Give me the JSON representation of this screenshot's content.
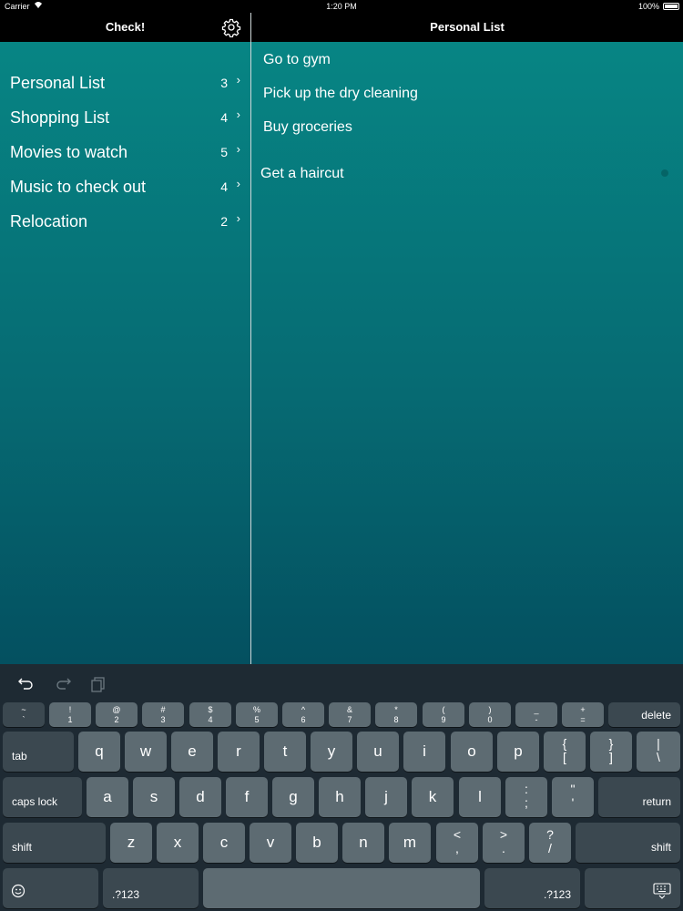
{
  "status": {
    "carrier": "Carrier",
    "time": "1:20 PM",
    "battery": "100%"
  },
  "master": {
    "title": "Check!",
    "lists": [
      {
        "name": "Personal List",
        "count": "3"
      },
      {
        "name": "Shopping List",
        "count": "4"
      },
      {
        "name": "Movies to watch",
        "count": "5"
      },
      {
        "name": "Music to check out",
        "count": "4"
      },
      {
        "name": "Relocation",
        "count": "2"
      }
    ]
  },
  "detail": {
    "title": "Personal List",
    "items": [
      "Go to gym",
      "Pick up the dry cleaning",
      "Buy groceries",
      "Get a haircut"
    ]
  },
  "keyboard": {
    "num_row": [
      [
        "~",
        "`"
      ],
      [
        "!",
        "1"
      ],
      [
        "@",
        "2"
      ],
      [
        "#",
        "3"
      ],
      [
        "$",
        "4"
      ],
      [
        "%",
        "5"
      ],
      [
        "^",
        "6"
      ],
      [
        "&",
        "7"
      ],
      [
        "*",
        "8"
      ],
      [
        "(",
        "9"
      ],
      [
        ")",
        "0"
      ],
      [
        "_",
        "-"
      ],
      [
        "+",
        "="
      ]
    ],
    "delete": "delete",
    "tab": "tab",
    "row1": [
      "q",
      "w",
      "e",
      "r",
      "t",
      "y",
      "u",
      "i",
      "o",
      "p"
    ],
    "row1_sym": [
      [
        "{",
        "["
      ],
      [
        "}",
        "]"
      ],
      [
        "|",
        "\\"
      ]
    ],
    "caps_lock": "caps lock",
    "row2": [
      "a",
      "s",
      "d",
      "f",
      "g",
      "h",
      "j",
      "k",
      "l"
    ],
    "row2_sym": [
      [
        ":",
        ";"
      ],
      [
        "\"",
        "'"
      ]
    ],
    "return": "return",
    "shift": "shift",
    "row3": [
      "z",
      "x",
      "c",
      "v",
      "b",
      "n",
      "m"
    ],
    "row3_sym": [
      [
        "<",
        ","
      ],
      [
        ">",
        "."
      ],
      [
        "?",
        "/"
      ]
    ],
    "numbers_key": ".?123"
  }
}
